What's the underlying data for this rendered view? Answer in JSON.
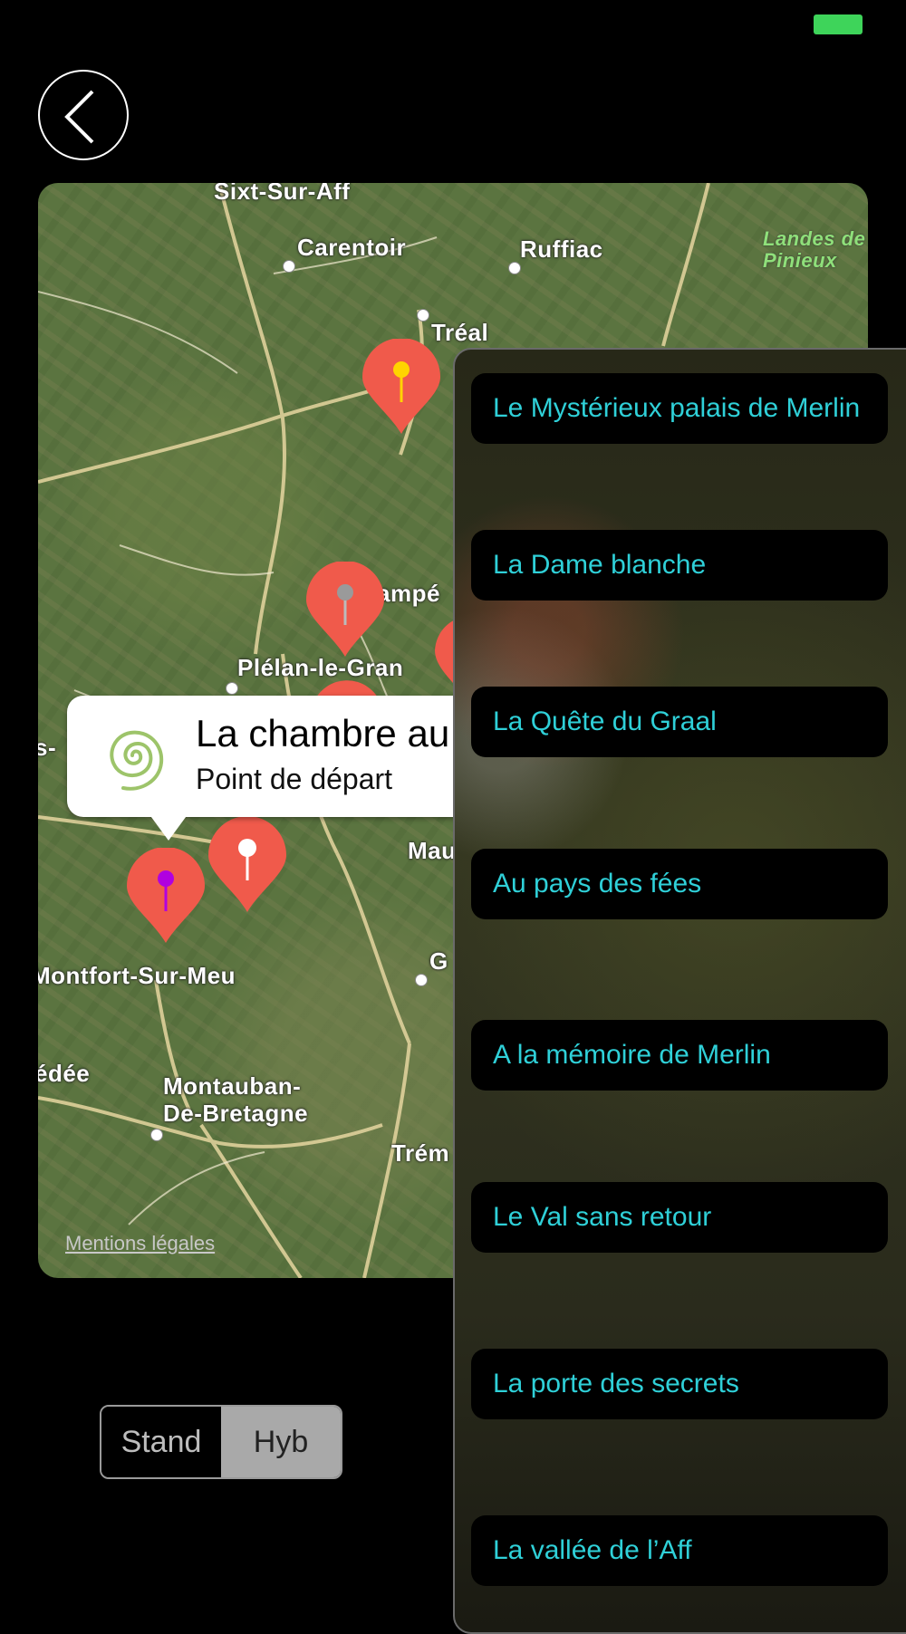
{
  "status_bar": {
    "battery_color": "#3ed45a"
  },
  "nav": {
    "back_icon": "chevron-left-icon"
  },
  "map": {
    "places": [
      "Sixt-Sur-Aff",
      "Carentoir",
      "Ruffiac",
      "Landes de\nPinieux",
      "Tréal",
      "ampé",
      "Plélan-le-Gran",
      "s-",
      "Mau",
      "G",
      "Montfort-Sur-Meu",
      "édée",
      "Montauban-\nDe-Bretagne",
      "Trém"
    ],
    "legal_link": "Mentions légales",
    "pins": [
      {
        "name": "pin-yellow",
        "head_color": "#ffd400"
      },
      {
        "name": "pin-gray",
        "head_color": "#9a9a9a"
      },
      {
        "name": "pin-partial",
        "head_color": "#e85545"
      },
      {
        "name": "pin-partial-2",
        "head_color": "#e85545"
      },
      {
        "name": "pin-white",
        "head_color": "#ffffff"
      },
      {
        "name": "pin-purple",
        "head_color": "#b000e0"
      }
    ],
    "pin_color": "#f05a4b"
  },
  "callout": {
    "title": "La chambre au",
    "subtitle": "Point de départ",
    "icon": "spiral-icon"
  },
  "map_type": {
    "options": [
      "Stand",
      "Hyb"
    ],
    "selected": "Hyb"
  },
  "stories": [
    "Le Mystérieux palais de Merlin",
    "La Dame blanche",
    "La Quête du Graal",
    "Au pays des fées",
    "A la mémoire de Merlin",
    "Le Val sans retour",
    "La porte des secrets",
    "La vallée de l’Aff"
  ],
  "colors": {
    "story_text": "#2fd0d8",
    "panel_border": "#6a6a6a"
  }
}
